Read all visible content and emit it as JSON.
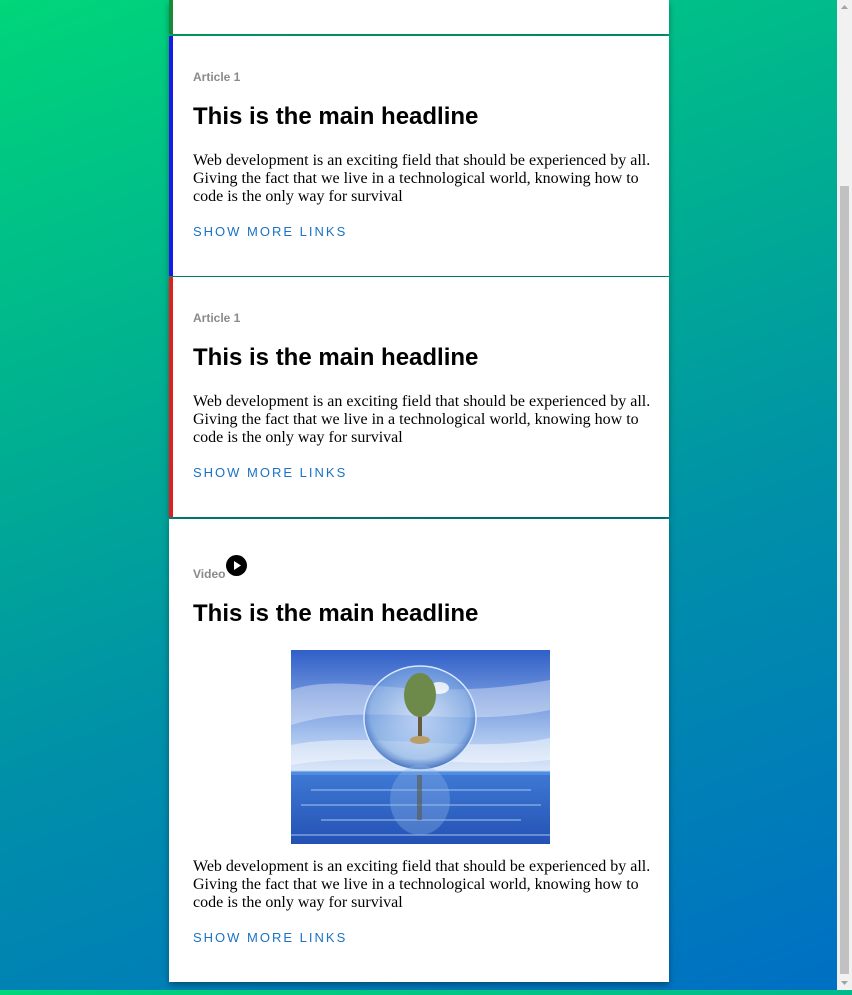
{
  "articles": [
    {
      "kicker": "Article 1",
      "headline": "This is the main headline",
      "body": "Web development is an exciting field that should be experienced by all. Giving the fact that we live in a technological world, knowing how to code is the only way for survival",
      "link": "SHOW MORE LINKS",
      "accent_color": "#1a1ae6"
    },
    {
      "kicker": "Article 1",
      "headline": "This is the main headline",
      "body": "Web development is an exciting field that should be experienced by all. Giving the fact that we live in a technological world, knowing how to code is the only way for survival",
      "link": "SHOW MORE LINKS",
      "accent_color": "#e02020"
    }
  ],
  "video": {
    "kicker": "Video",
    "headline": "This is the main headline",
    "body": "Web development is an exciting field that should be experienced by all. Giving the fact that we live in a technological world, knowing how to code is the only way for survival",
    "link": "SHOW MORE LINKS",
    "icon": "play-icon"
  },
  "top_card_accent": "#1a8a3a"
}
